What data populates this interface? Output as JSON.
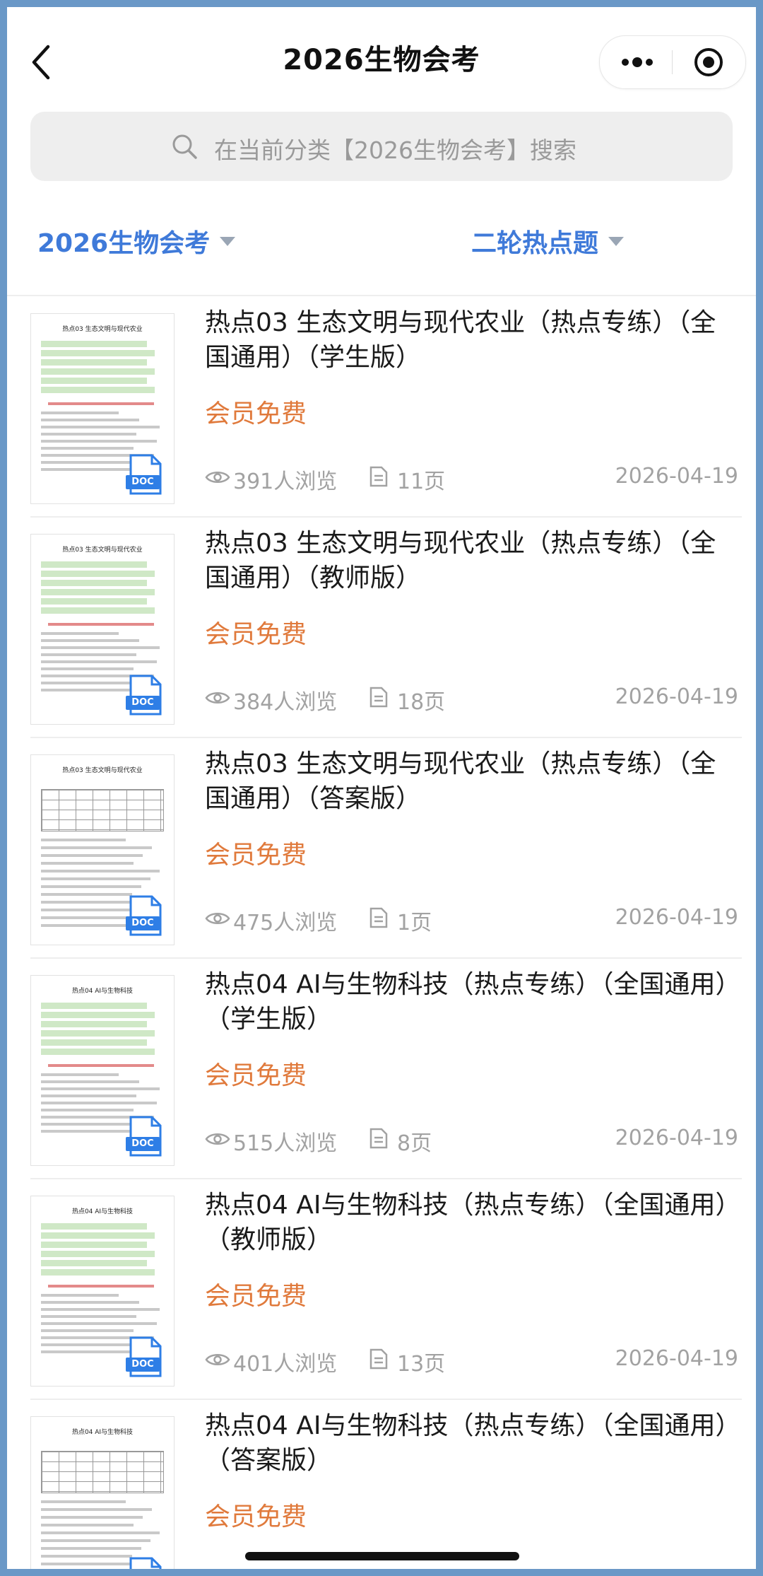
{
  "header": {
    "title": "2026生物会考",
    "back_icon": "chevron-left-icon",
    "more_icon": "more-dots-icon",
    "close_icon": "target-circle-icon"
  },
  "search": {
    "placeholder": "在当前分类【2026生物会考】搜索",
    "icon": "search-icon"
  },
  "filters": {
    "left": "2026生物会考",
    "right": "二轮热点题"
  },
  "colors": {
    "accent": "#3f7ad9",
    "price": "#e07a3c",
    "meta": "#a2a2a2",
    "frame": "#6a98c7"
  },
  "items": [
    {
      "title": "热点03 生态文明与现代农业（热点专练）（全国通用）（学生版）",
      "price": "会员免费",
      "views": "391人浏览",
      "pages": "11页",
      "date": "2026-04-19",
      "thumb_title": "热点03 生态文明与现代农业",
      "file_type": "DOC"
    },
    {
      "title": "热点03 生态文明与现代农业（热点专练）（全国通用）（教师版）",
      "price": "会员免费",
      "views": "384人浏览",
      "pages": "18页",
      "date": "2026-04-19",
      "thumb_title": "热点03 生态文明与现代农业",
      "file_type": "DOC"
    },
    {
      "title": "热点03 生态文明与现代农业（热点专练）（全国通用）（答案版）",
      "price": "会员免费",
      "views": "475人浏览",
      "pages": "1页",
      "date": "2026-04-19",
      "thumb_title": "热点03 生态文明与现代农业",
      "file_type": "DOC"
    },
    {
      "title": "热点04 AI与生物科技（热点专练）（全国通用）（学生版）",
      "price": "会员免费",
      "views": "515人浏览",
      "pages": "8页",
      "date": "2026-04-19",
      "thumb_title": "热点04 AI与生物科技",
      "file_type": "DOC"
    },
    {
      "title": "热点04 AI与生物科技（热点专练）（全国通用）（教师版）",
      "price": "会员免费",
      "views": "401人浏览",
      "pages": "13页",
      "date": "2026-04-19",
      "thumb_title": "热点04 AI与生物科技",
      "file_type": "DOC"
    },
    {
      "title": "热点04 AI与生物科技（热点专练）（全国通用）（答案版）",
      "price": "会员免费",
      "views": "",
      "pages": "",
      "date": "",
      "thumb_title": "热点04 AI与生物科技",
      "file_type": "DOC"
    }
  ]
}
